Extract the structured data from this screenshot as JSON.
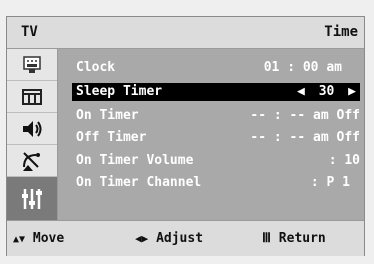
{
  "header": {
    "source": "TV",
    "title": "Time"
  },
  "sidebar": {
    "items": [
      {
        "icon": "picture-icon"
      },
      {
        "icon": "channel-icon"
      },
      {
        "icon": "sound-icon"
      },
      {
        "icon": "antenna-icon"
      },
      {
        "icon": "setup-icon",
        "selected": true
      }
    ]
  },
  "menu": {
    "clock": {
      "label": "Clock",
      "value": "01 : 00 am"
    },
    "sleep_timer": {
      "label": "Sleep Timer",
      "value": "30",
      "left_arrow": "◀",
      "right_arrow": "▶"
    },
    "on_timer": {
      "label": "On Timer",
      "value": "-- : -- am Off"
    },
    "off_timer": {
      "label": "Off Timer",
      "value": "-- : -- am Off"
    },
    "on_timer_volume": {
      "label": "On Timer Volume",
      "value": ": 10"
    },
    "on_timer_channel": {
      "label": "On Timer Channel",
      "value": ": P 1"
    }
  },
  "footer": {
    "move_icon": "▲▼",
    "move_label": "Move",
    "adjust_icon": "◀▶",
    "adjust_label": "Adjust",
    "return_icon": "Ⅲ",
    "return_label": "Return"
  }
}
